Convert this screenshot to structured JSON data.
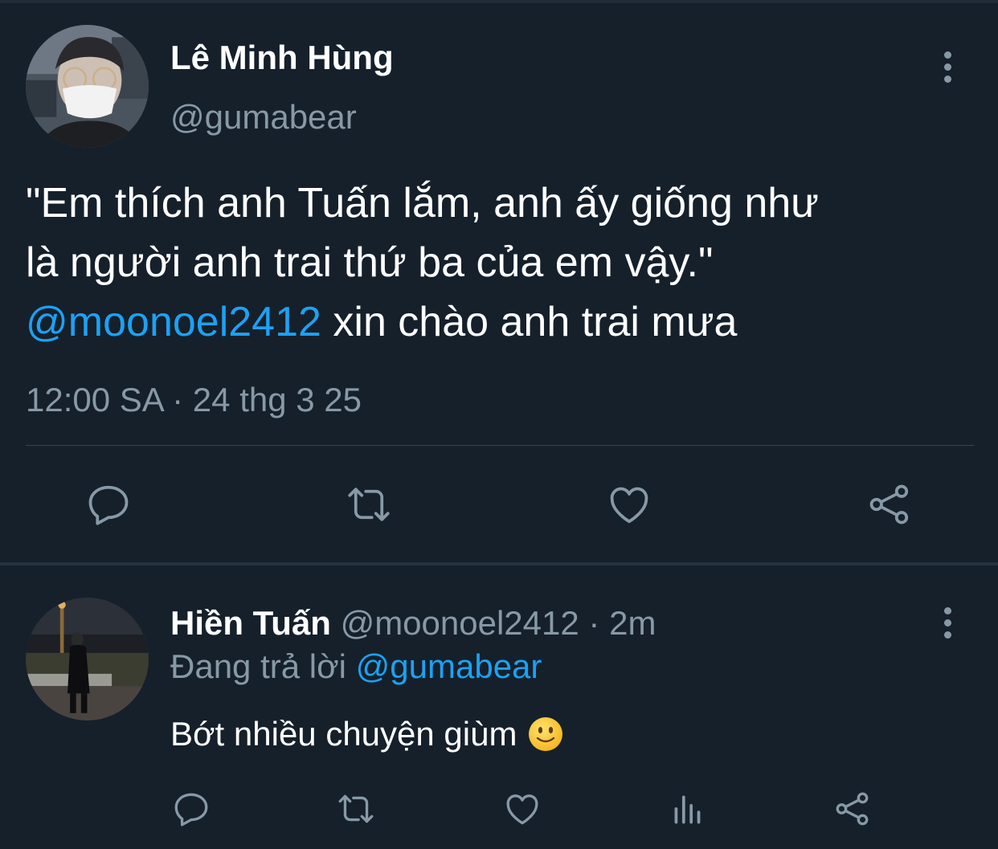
{
  "main_tweet": {
    "author_name": "Lê Minh Hùng",
    "author_handle": "@gumabear",
    "text_line1": "\"Em thích anh Tuấn lắm, anh ấy giống như",
    "text_line2": "là người anh trai thứ ba của em vậy.\"",
    "mention": "@moonoel2412",
    "text_line3_rest": " xin chào anh trai mưa",
    "timestamp": "12:00 SA · 24 thg 3 25",
    "actions": [
      "reply-icon",
      "retweet-icon",
      "like-icon",
      "share-icon"
    ]
  },
  "reply_tweet": {
    "author_name": "Hiền Tuấn",
    "author_handle": "@moonoel2412",
    "time_ago": "2m",
    "replying_label": "Đang trả lời",
    "replying_to": "@gumabear",
    "text": "Bớt nhiều chuyện giùm",
    "emoji": "slightly-smiling-face",
    "actions": [
      "reply-icon",
      "retweet-icon",
      "like-icon",
      "analytics-icon",
      "share-icon"
    ]
  },
  "colors": {
    "background": "#15202b",
    "text": "#ffffff",
    "secondary": "#8899a6",
    "accent": "#1da1f2",
    "separator": "#38444d"
  }
}
